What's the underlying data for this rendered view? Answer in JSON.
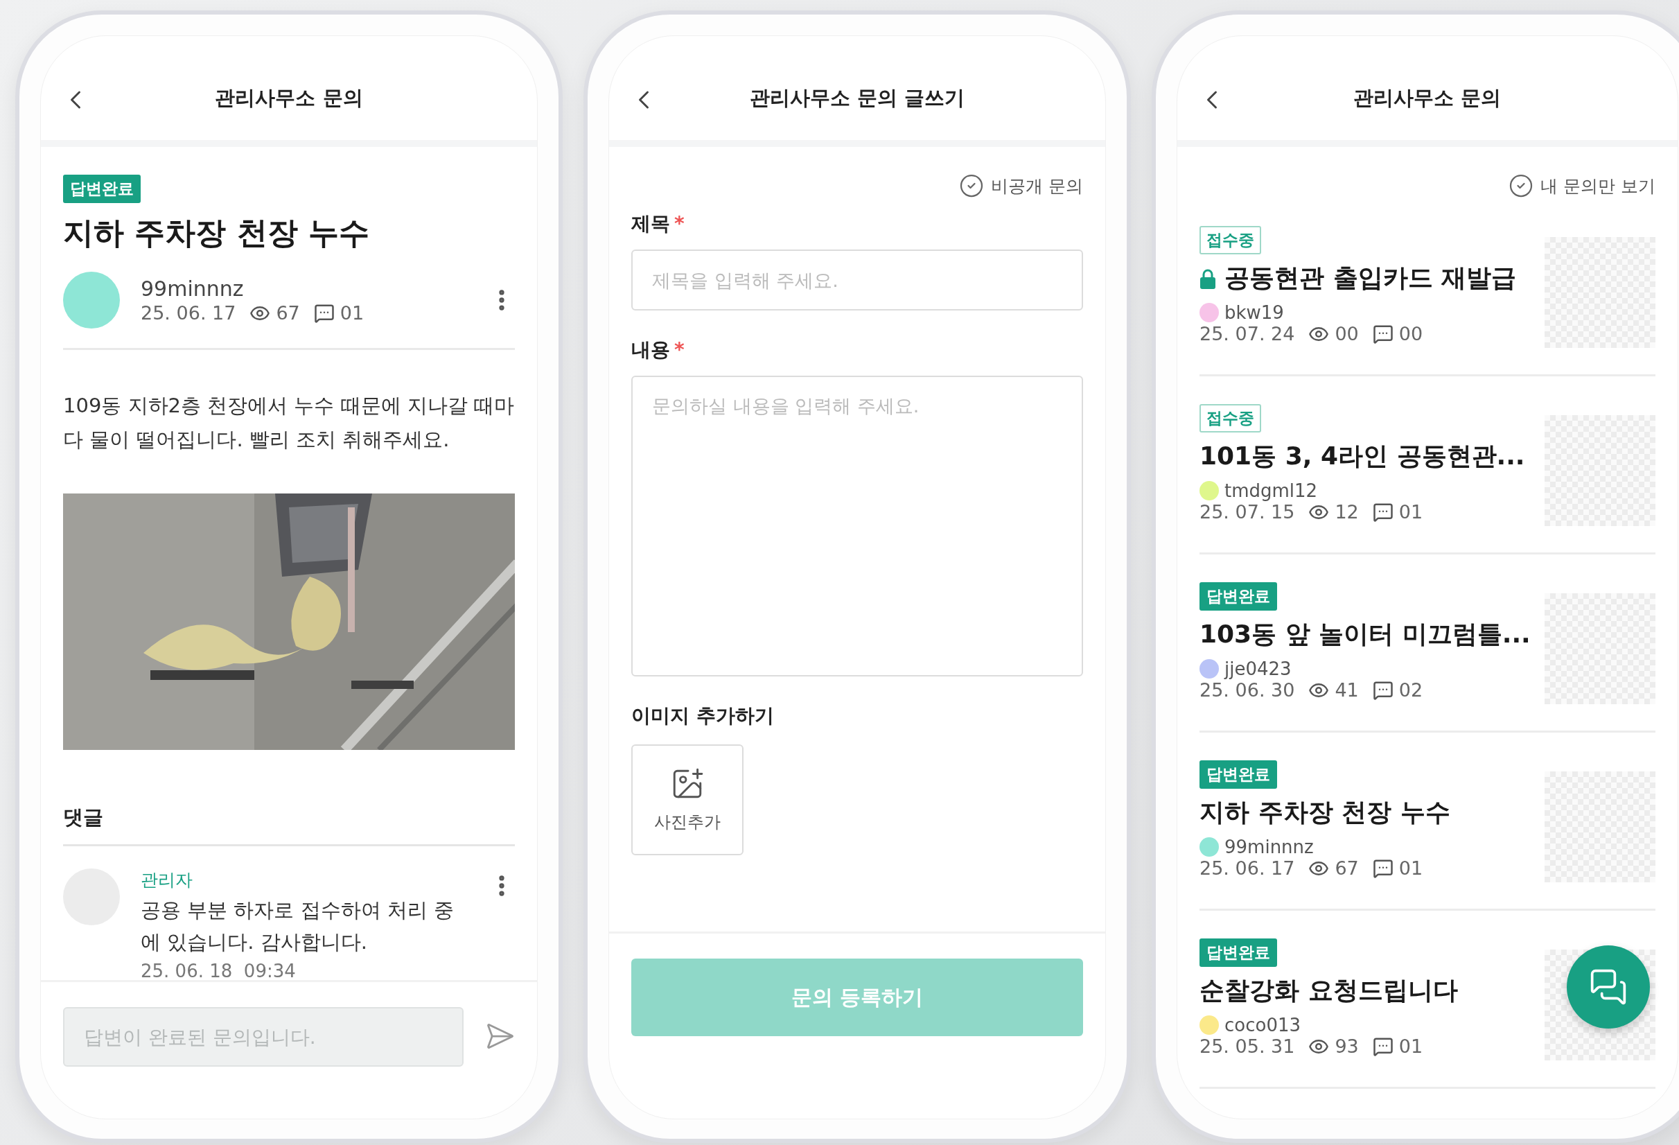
{
  "screens": [
    {
      "kind": "detail",
      "header": {
        "title": "관리사무소 문의"
      },
      "status": {
        "kind": "answered",
        "label": "답변완료"
      },
      "title": "지하 주차장 천장 누수",
      "author": {
        "name": "99minnnz",
        "color": "#8ee6d6"
      },
      "date": "25. 06. 17",
      "views": "67",
      "comment_count": "01",
      "body": "109동 지하2층 천장에서 누수 때문에 지나갈 때마다 물이 떨어집니다. 빨리 조치 취해주세요.",
      "comments": {
        "heading": "댓글",
        "items": [
          {
            "author": "관리자",
            "text": "공용 부분 하자로 접수하여 처리 중에 있습니다. 감사합니다.",
            "time": "25. 06. 18  09:34"
          }
        ]
      },
      "reply": {
        "placeholder": "답변이 완료된 문의입니다.",
        "disabled": true
      }
    },
    {
      "kind": "form",
      "header": {
        "title": "관리사무소 문의 글쓰기"
      },
      "private_toggle": {
        "label": "비공개 문의",
        "checked": false
      },
      "fields": [
        {
          "kind": "text",
          "label": "제목",
          "required_mark": "*",
          "placeholder": "제목을 입력해 주세요."
        },
        {
          "kind": "textarea",
          "label": "내용",
          "required_mark": "*",
          "placeholder": "문의하실 내용을 입력해 주세요."
        }
      ],
      "image_section": {
        "heading": "이미지 추가하기",
        "add_label": "사진추가"
      },
      "submit": {
        "label": "문의 등록하기",
        "disabled": true
      }
    },
    {
      "kind": "list",
      "header": {
        "title": "관리사무소 문의"
      },
      "filter": {
        "label": "내 문의만 보기",
        "checked": false
      },
      "posts": [
        {
          "status": {
            "kind": "received",
            "label": "접수중"
          },
          "locked": true,
          "title": "공동현관 출입카드 재발급",
          "author": "bkw19",
          "color": "#f7c3e8",
          "date": "25. 07. 24",
          "views": "00",
          "comments": "00"
        },
        {
          "status": {
            "kind": "received",
            "label": "접수중"
          },
          "locked": false,
          "title": "101동 3, 4라인 공동현관...",
          "author": "tmdgml12",
          "color": "#dff78c",
          "date": "25. 07. 15",
          "views": "12",
          "comments": "01"
        },
        {
          "status": {
            "kind": "answered",
            "label": "답변완료"
          },
          "locked": false,
          "title": "103동 앞 놀이터 미끄럼틀...",
          "author": "jje0423",
          "color": "#b9c3f7",
          "date": "25. 06. 30",
          "views": "41",
          "comments": "02"
        },
        {
          "status": {
            "kind": "answered",
            "label": "답변완료"
          },
          "locked": false,
          "title": "지하 주차장 천장 누수",
          "author": "99minnnz",
          "color": "#8ee6d6",
          "date": "25. 06. 17",
          "views": "67",
          "comments": "01"
        },
        {
          "status": {
            "kind": "answered",
            "label": "답변완료"
          },
          "locked": false,
          "title": "순찰강화 요청드립니다",
          "author": "coco013",
          "color": "#fbe98a",
          "date": "25. 05. 31",
          "views": "93",
          "comments": "01"
        }
      ],
      "fab": {
        "kind": "chat"
      }
    }
  ]
}
